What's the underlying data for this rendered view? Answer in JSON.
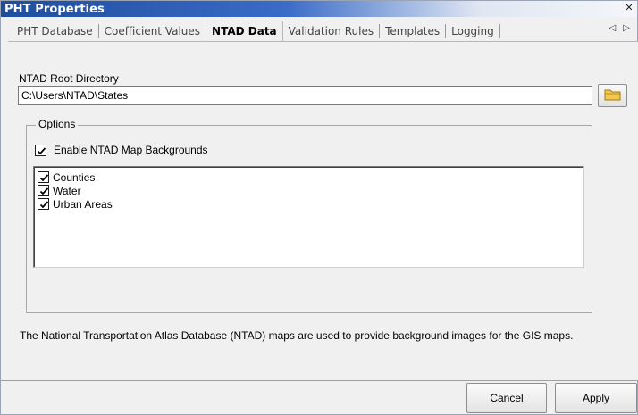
{
  "window": {
    "title": "PHT Properties",
    "close_glyph": "✕"
  },
  "tabs": [
    {
      "label": "PHT Database",
      "active": false
    },
    {
      "label": "Coefficient Values",
      "active": false
    },
    {
      "label": "NTAD Data",
      "active": true
    },
    {
      "label": "Validation Rules",
      "active": false
    },
    {
      "label": "Templates",
      "active": false
    },
    {
      "label": "Logging",
      "active": false
    }
  ],
  "tab_scroll": {
    "left": "◁",
    "right": "▷"
  },
  "root_directory": {
    "label": "NTAD Root Directory",
    "value": "C:\\Users\\NTAD\\States",
    "browse_icon": "folder-icon"
  },
  "options": {
    "legend": "Options",
    "enable_backgrounds": {
      "label": "Enable NTAD Map Backgrounds",
      "checked": true
    },
    "layers": [
      {
        "label": "Counties",
        "checked": true
      },
      {
        "label": "Water",
        "checked": true
      },
      {
        "label": "Urban Areas",
        "checked": true
      }
    ]
  },
  "description": "The National Transportation Atlas Database (NTAD) maps are used to provide background images for the GIS maps.",
  "buttons": {
    "cancel": "Cancel",
    "apply": "Apply"
  },
  "colors": {
    "title_bar": "#1f4d9e",
    "folder_icon": "#f2c94c"
  }
}
